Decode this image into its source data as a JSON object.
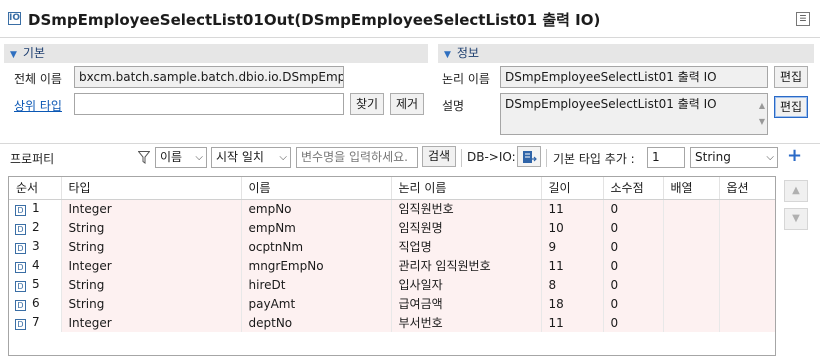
{
  "title": "DSmpEmployeeSelectList01Out(DSmpEmployeeSelectList01 출력 IO)",
  "basic": {
    "header": "기본",
    "full_name_label": "전체 이름",
    "full_name_value": "bxcm.batch.sample.batch.dbio.io.DSmpEmployee",
    "parent_type_label": "상위 타입",
    "parent_type_value": "",
    "find_button": "찾기",
    "remove_button": "제거"
  },
  "info": {
    "header": "정보",
    "logical_name_label": "논리 이름",
    "logical_name_value": "DSmpEmployeeSelectList01 출력 IO",
    "logical_edit_button": "편집",
    "description_label": "설명",
    "description_value": "DSmpEmployeeSelectList01 출력 IO",
    "description_edit_button": "편집"
  },
  "toolbar": {
    "properties_label": "프로퍼티",
    "filter_field": "이름",
    "match_mode": "시작 일치",
    "search_placeholder": "변수명을 입력하세요.",
    "search_button": "검색",
    "db_io_label": "DB->IO:",
    "basic_type_add_label": "기본 타입 추가 :",
    "add_count": "1",
    "type_select": "String"
  },
  "table": {
    "columns": [
      "순서",
      "타입",
      "이름",
      "논리 이름",
      "길이",
      "소수점",
      "배열",
      "옵션"
    ],
    "rows": [
      {
        "order": "1",
        "type": "Integer",
        "name": "empNo",
        "logical": "임직원번호",
        "length": "11",
        "decimal": "0",
        "array": "",
        "option": ""
      },
      {
        "order": "2",
        "type": "String",
        "name": "empNm",
        "logical": "임직원명",
        "length": "10",
        "decimal": "0",
        "array": "",
        "option": ""
      },
      {
        "order": "3",
        "type": "String",
        "name": "ocptnNm",
        "logical": "직업명",
        "length": "9",
        "decimal": "0",
        "array": "",
        "option": ""
      },
      {
        "order": "4",
        "type": "Integer",
        "name": "mngrEmpNo",
        "logical": "관리자 임직원번호",
        "length": "11",
        "decimal": "0",
        "array": "",
        "option": ""
      },
      {
        "order": "5",
        "type": "String",
        "name": "hireDt",
        "logical": "입사일자",
        "length": "8",
        "decimal": "0",
        "array": "",
        "option": ""
      },
      {
        "order": "6",
        "type": "String",
        "name": "payAmt",
        "logical": "급여금액",
        "length": "18",
        "decimal": "0",
        "array": "",
        "option": ""
      },
      {
        "order": "7",
        "type": "Integer",
        "name": "deptNo",
        "logical": "부서번호",
        "length": "11",
        "decimal": "0",
        "array": "",
        "option": ""
      }
    ]
  },
  "colors": {
    "accent": "#2a6ac7",
    "row_tint": "#fdf1f1",
    "section_bg": "#e6e6e6"
  }
}
